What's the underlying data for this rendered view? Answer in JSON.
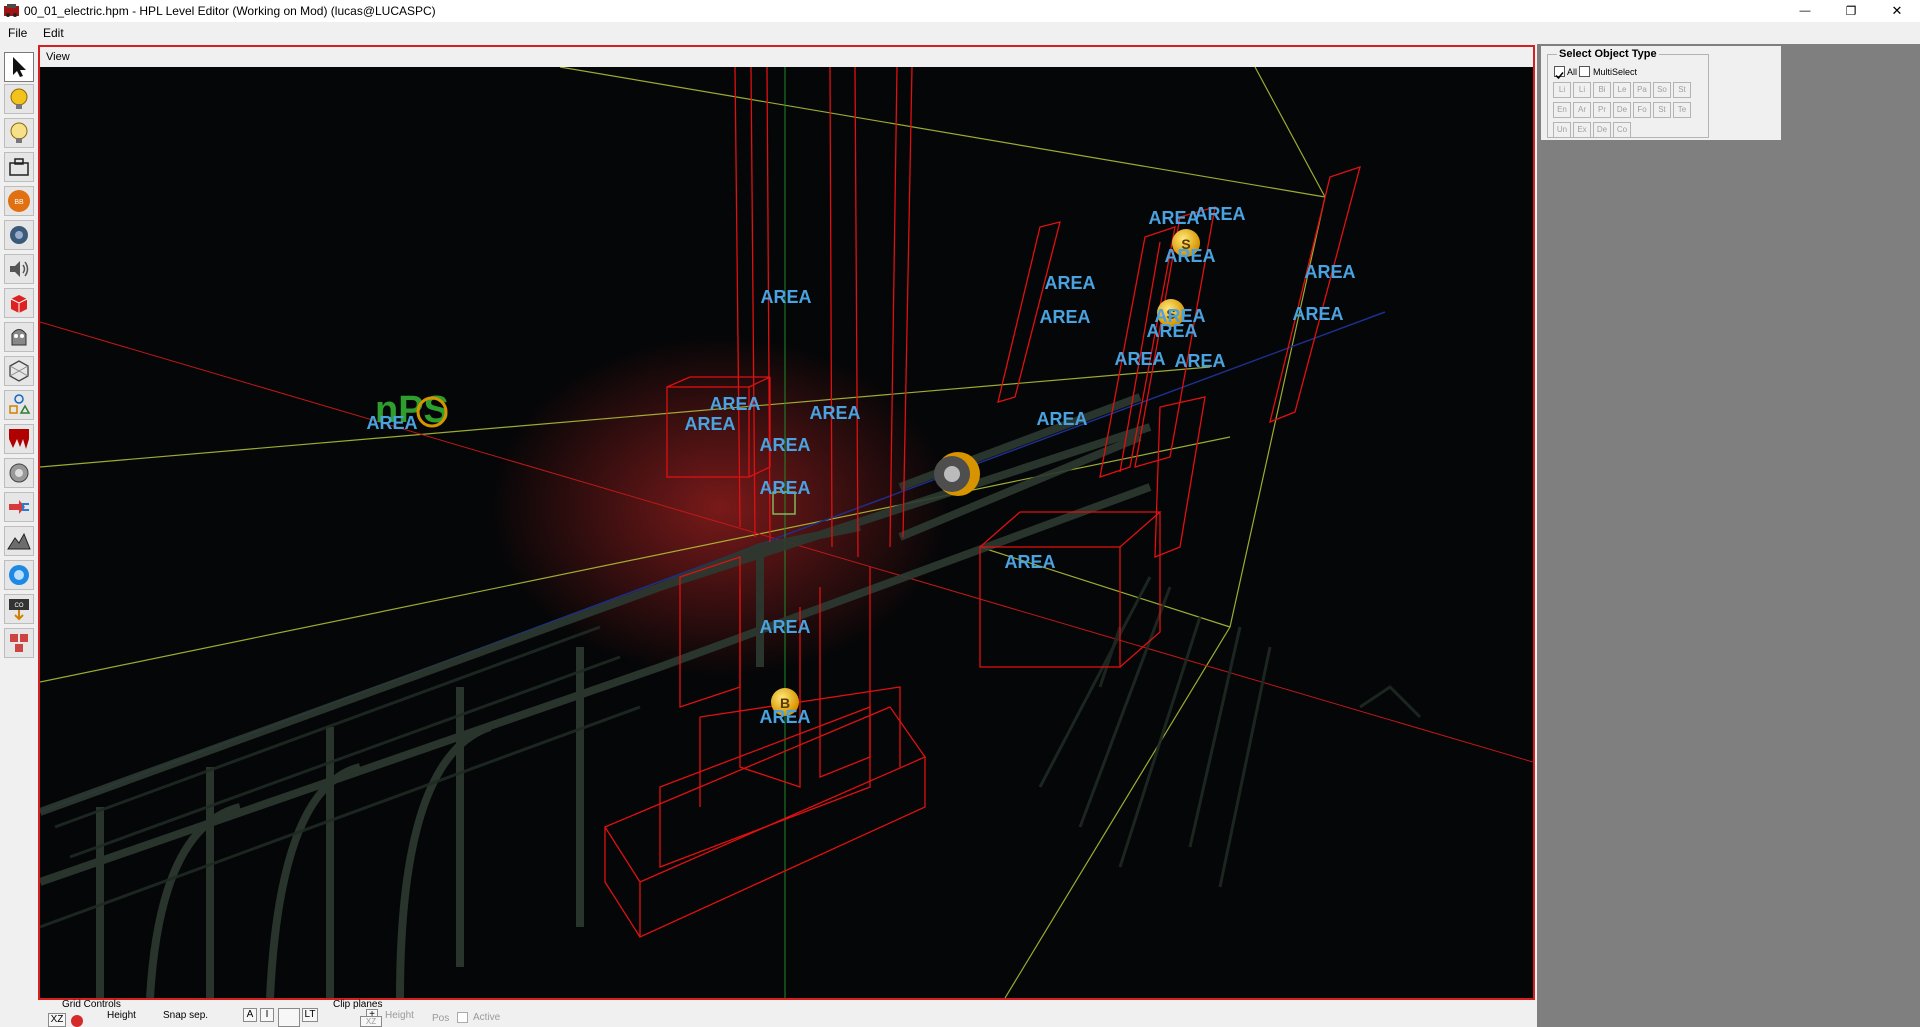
{
  "window": {
    "title": "00_01_electric.hpm - HPL Level Editor (Working on Mod)  (lucas@LUCASPC)",
    "minimize_glyph": "—",
    "maximize_glyph": "❐",
    "close_glyph": "✕"
  },
  "menu": {
    "file": "File",
    "edit": "Edit"
  },
  "toolbar": {
    "tools": [
      {
        "name": "select-tool-icon"
      },
      {
        "name": "light-tool-icon"
      },
      {
        "name": "spotlight-tool-icon"
      },
      {
        "name": "static-object-tool-icon"
      },
      {
        "name": "billboard-tool-icon"
      },
      {
        "name": "particle-tool-icon"
      },
      {
        "name": "sound-tool-icon"
      },
      {
        "name": "entity-tool-icon"
      },
      {
        "name": "area-tool-icon"
      },
      {
        "name": "primitive-tool-icon"
      },
      {
        "name": "shapes-tool-icon"
      },
      {
        "name": "decal-tool-icon"
      },
      {
        "name": "fog-tool-icon"
      },
      {
        "name": "combine-tool-icon"
      },
      {
        "name": "terrain-tool-icon"
      },
      {
        "name": "skybox-tool-icon"
      },
      {
        "name": "combo-tool-icon"
      },
      {
        "name": "group-tool-icon"
      }
    ],
    "active_index": 0
  },
  "viewport": {
    "header": "View",
    "area_label": "AREA"
  },
  "select_panel": {
    "title": "Select Object Type",
    "all_label": "All",
    "all_checked": true,
    "multiselect_label": "MultiSelect",
    "multiselect_checked": false,
    "types_row1": [
      "Li",
      "Li",
      "Bi",
      "Le",
      "Pa",
      "So",
      "St"
    ],
    "types_row2": [
      "En",
      "Ar",
      "Pr",
      "De",
      "Fo",
      "St",
      "Te"
    ],
    "types_row3": [
      "Un",
      "Ex",
      "De",
      "Co"
    ]
  },
  "bottom": {
    "grid_controls": "Grid Controls",
    "height": "Height",
    "snap_sep": "Snap sep.",
    "xz": "XZ",
    "a": "A",
    "i": "I",
    "lt": "LT",
    "clip_planes": "Clip planes",
    "plus": "+",
    "clip_xz": "XZ",
    "clip_height": "Height",
    "clip_pos": "Pos",
    "active": "Active"
  },
  "colors": {
    "accent_red": "#d61f1f",
    "area_label": "#4aa3e0",
    "wire_red": "#e01010",
    "wire_yellow": "#b8c83a",
    "panel_gray": "#7f7f7f"
  }
}
